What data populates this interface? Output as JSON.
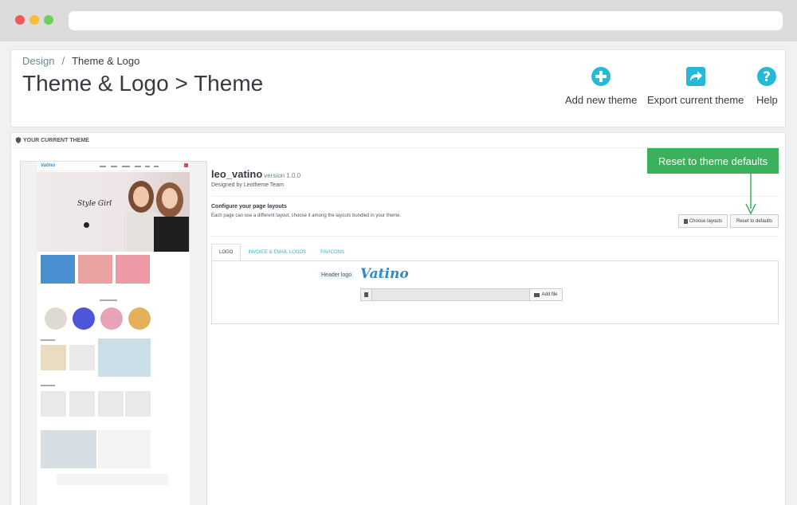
{
  "browser": {
    "controls": [
      "close",
      "minimize",
      "maximize"
    ]
  },
  "breadcrumb": {
    "parent": "Design",
    "separator": "/",
    "current": "Theme & Logo"
  },
  "page_title": "Theme & Logo > Theme",
  "toolbar": {
    "add_label": "Add new theme",
    "add_icon": "plus-circle-icon",
    "export_label": "Export current theme",
    "export_icon": "share-icon",
    "help_label": "Help",
    "help_icon": "question-circle-icon"
  },
  "panel": {
    "heading": "YOUR CURRENT THEME",
    "heading_icon": "shield-icon"
  },
  "preview": {
    "logo": "Vatino",
    "hero_script": "Style Girl"
  },
  "theme": {
    "name": "leo_vatino",
    "version": "version 1.0.0",
    "designed_by": "Designed by Leotheme Team"
  },
  "layouts": {
    "title": "Configure your page layouts",
    "description": "Each page can use a different layout, choose it among the layouts bundled in your theme.",
    "choose_label": "Choose layouts",
    "reset_label": "Reset to defaults"
  },
  "callout": {
    "label": "Reset to theme defaults",
    "color": "#3bb15c"
  },
  "tabs": [
    {
      "label": "LOGO",
      "active": true
    },
    {
      "label": "INVOICE & EMAIL LOGOS",
      "active": false
    },
    {
      "label": "FAVICONS",
      "active": false
    }
  ],
  "logo_tab": {
    "header_logo_label": "Header logo",
    "logo_text": "Vatino",
    "file_value": "",
    "add_file_label": "Add file"
  },
  "colors": {
    "accent": "#25b9d7",
    "title": "#363a41"
  }
}
